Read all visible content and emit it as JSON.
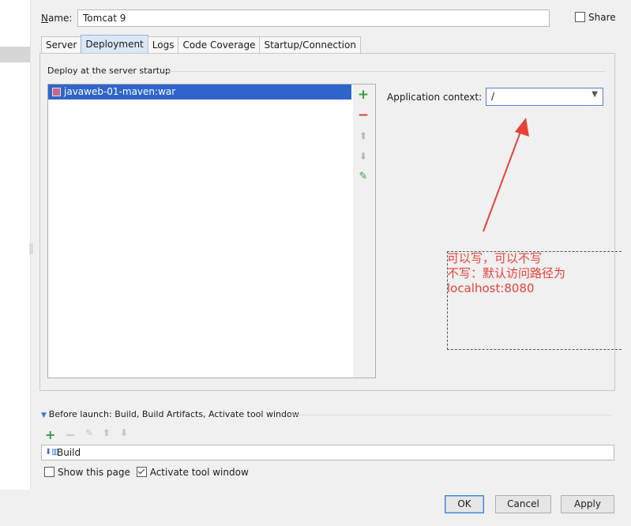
{
  "header": {
    "name_label": "Name:",
    "name_value": "Tomcat 9",
    "share_label": "Share",
    "share_checked": false
  },
  "tabs": [
    {
      "label": "Server",
      "active": false
    },
    {
      "label": "Deployment",
      "active": true
    },
    {
      "label": "Logs",
      "active": false
    },
    {
      "label": "Code Coverage",
      "active": false
    },
    {
      "label": "Startup/Connection",
      "active": false
    }
  ],
  "deploy": {
    "group_title": "Deploy at the server startup",
    "items": [
      "javaweb-01-maven:war"
    ],
    "tool_icons": [
      "add-icon",
      "remove-icon",
      "move-up-icon",
      "move-down-icon",
      "edit-icon"
    ],
    "context_label": "Application context:",
    "context_value": "/"
  },
  "annotation": {
    "line1": "可以写，可以不写",
    "line2": "不写：默认访问路径为",
    "line3": "localhost:8080",
    "color": "#e8413a"
  },
  "before_launch": {
    "title": "Before launch: Build, Build Artifacts, Activate tool window",
    "tool_icons": [
      "add-icon",
      "remove-icon",
      "edit-icon",
      "move-up-icon",
      "move-down-icon"
    ],
    "items": [
      "Build"
    ]
  },
  "options": {
    "show_page_label": "Show this page",
    "show_page_checked": false,
    "activate_label": "Activate tool window",
    "activate_checked": true
  },
  "buttons": {
    "ok": "OK",
    "cancel": "Cancel",
    "apply": "Apply"
  },
  "colors": {
    "selection": "#2f65ca",
    "add": "#3a9a3a",
    "remove": "#d04040",
    "arrow": "#e8413a"
  }
}
